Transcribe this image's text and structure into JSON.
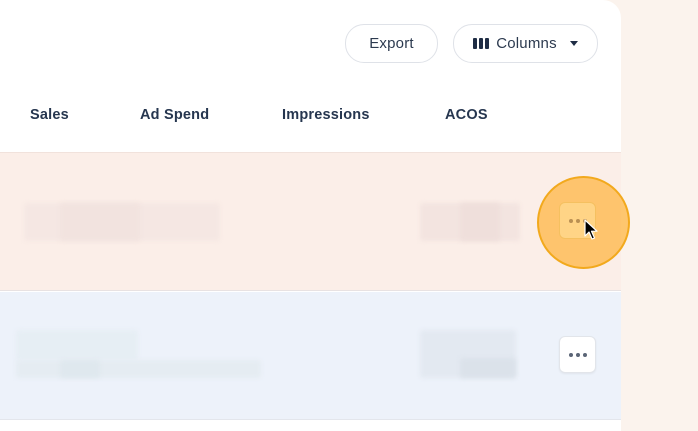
{
  "toolbar": {
    "export_label": "Export",
    "columns_label": "Columns",
    "columns_icon": "columns-icon",
    "columns_caret_icon": "caret-down-icon"
  },
  "table": {
    "columns": [
      "Sales",
      "Ad Spend",
      "Impressions",
      "ACOS"
    ],
    "rows": [
      {
        "state": "highlighted",
        "content": "blurred",
        "actions_icon": "more-horizontal-icon"
      },
      {
        "state": "normal",
        "content": "blurred",
        "actions_icon": "more-horizontal-icon"
      }
    ]
  },
  "colors": {
    "page_bg": "#fbf3ed",
    "row_highlight": "#fbeee8",
    "row_alt": "#edf2fa",
    "click_highlight": "#ffb84a"
  },
  "cursor": "pointer-cursor-icon"
}
